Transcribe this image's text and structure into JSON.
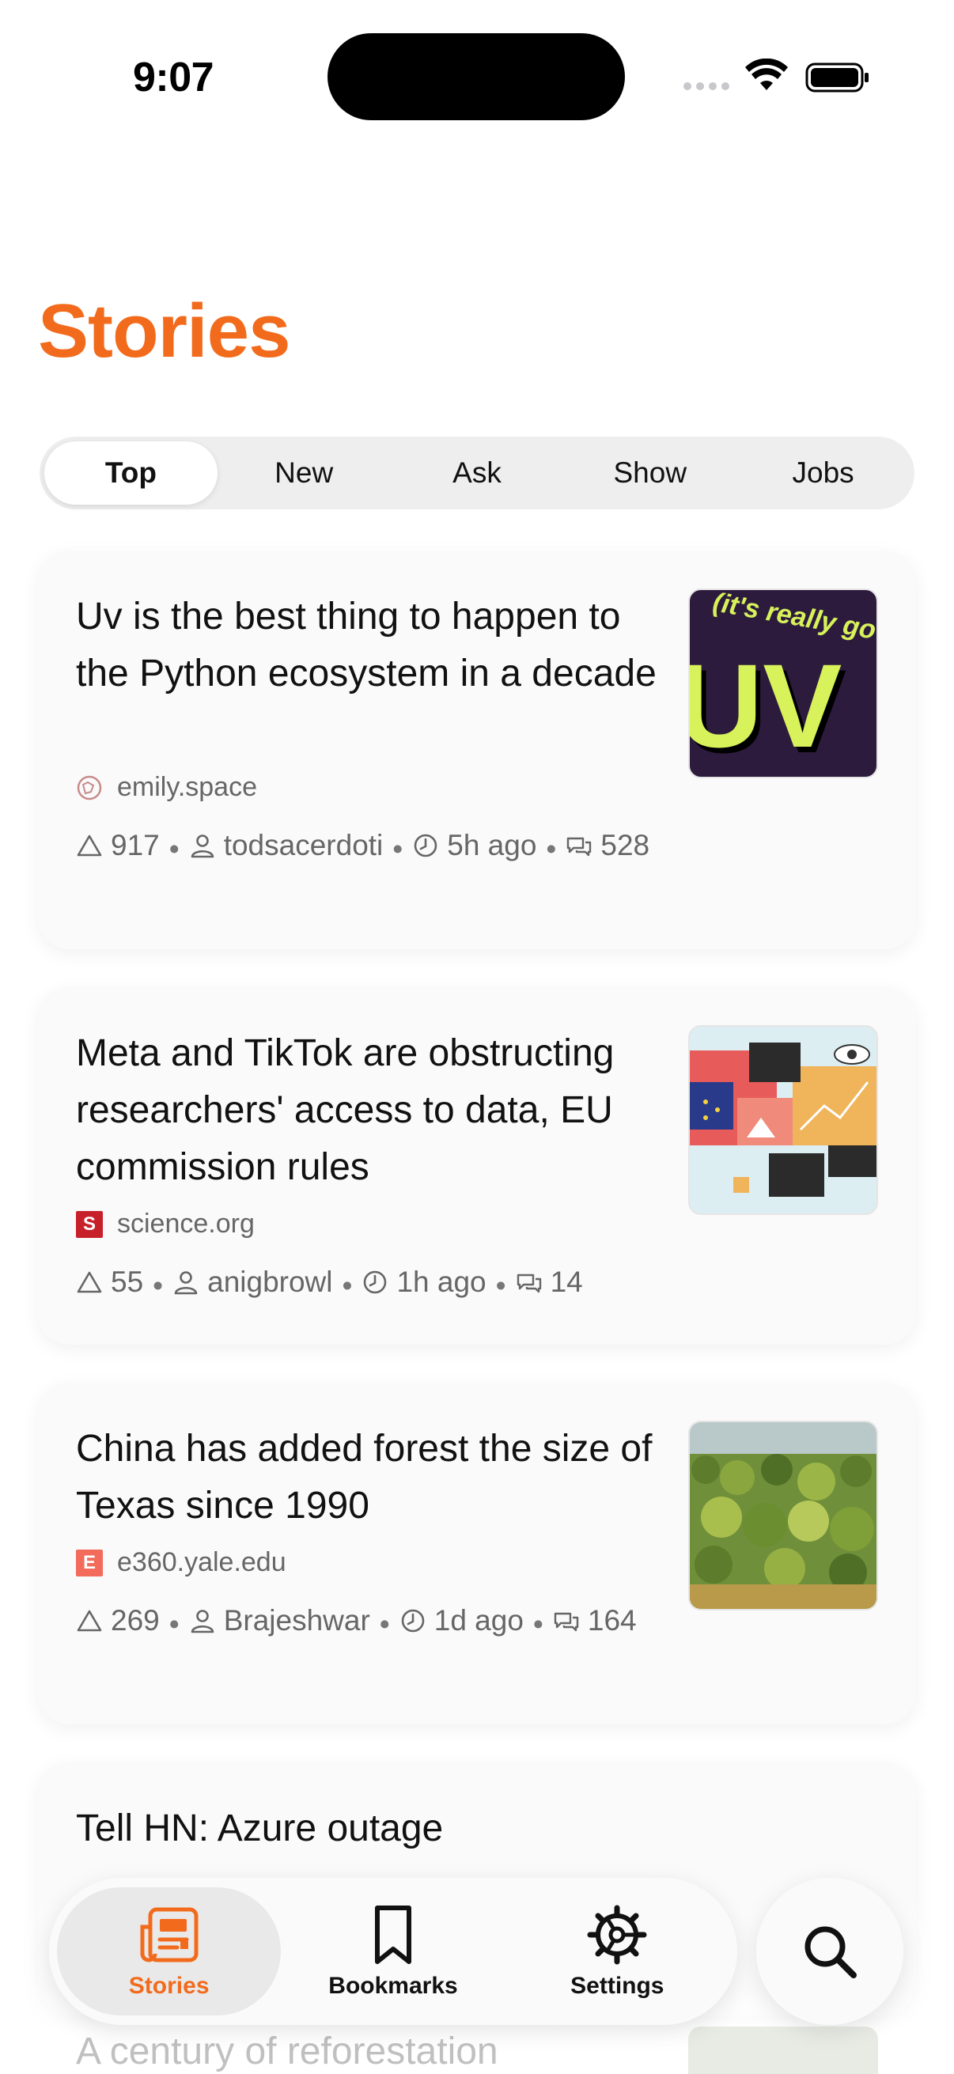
{
  "status_bar": {
    "time": "9:07"
  },
  "page": {
    "title": "Stories"
  },
  "tabs": [
    {
      "label": "Top",
      "active": true
    },
    {
      "label": "New",
      "active": false
    },
    {
      "label": "Ask",
      "active": false
    },
    {
      "label": "Show",
      "active": false
    },
    {
      "label": "Jobs",
      "active": false
    }
  ],
  "stories": [
    {
      "title": "Uv is the best thing to happen to the Python ecosystem in a decade",
      "source": "emily.space",
      "points": "917",
      "author": "todsacerdoti",
      "age": "5h ago",
      "comments": "528",
      "thumb_text": "(it's really go"
    },
    {
      "title": "Meta and TikTok are obstructing researchers' access to data, EU commission rules",
      "source": "science.org",
      "points": "55",
      "author": "anigbrowl",
      "age": "1h ago",
      "comments": "14",
      "favicon_letter": "S"
    },
    {
      "title": "China has added forest the size of Texas since 1990",
      "source": "e360.yale.edu",
      "points": "269",
      "author": "Brajeshwar",
      "age": "1d ago",
      "comments": "164",
      "favicon_letter": "E"
    },
    {
      "title": "Tell HN: Azure outage"
    },
    {
      "title": "A century of reforestation"
    }
  ],
  "tabbar": {
    "stories_label": "Stories",
    "bookmarks_label": "Bookmarks",
    "settings_label": "Settings"
  },
  "colors": {
    "accent": "#f26b1d"
  }
}
